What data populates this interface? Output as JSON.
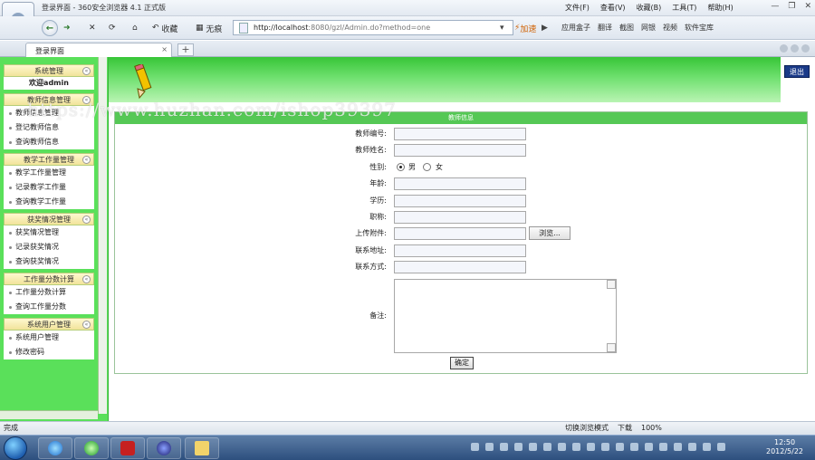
{
  "browser": {
    "title": "登录界面 - 360安全浏览器 4.1 正式版",
    "menus": [
      "文件(F)",
      "查看(V)",
      "收藏(B)",
      "工具(T)",
      "帮助(H)"
    ],
    "back_label": "收藏",
    "nologo_label": "无痕",
    "address_host": "http://localhost",
    "address_path": ":8080/gzl/Admin.do?method=one",
    "accelerate_label": "加速",
    "tools": [
      "应用盒子",
      "翻译",
      "截图",
      "网银",
      "视频",
      "软件宝库"
    ],
    "tab_title": "登录界面",
    "status_text": "完成",
    "status_right": [
      "切换浏览模式",
      "下载",
      "100%"
    ],
    "clock_time": "12:50",
    "clock_date": "2012/5/22"
  },
  "watermark": "https://www.huzhan.com/ishop39397",
  "sidebar": {
    "groups": [
      {
        "title": "系统管理",
        "welcome": "欢迎admin",
        "items": []
      },
      {
        "title": "教师信息管理",
        "items": [
          "教师信息管理",
          "登记教师信息",
          "查询教师信息"
        ]
      },
      {
        "title": "教学工作量管理",
        "items": [
          "教学工作量管理",
          "记录教学工作量",
          "查询教学工作量"
        ]
      },
      {
        "title": "获奖情况管理",
        "items": [
          "获奖情况管理",
          "记录获奖情况",
          "查询获奖情况"
        ]
      },
      {
        "title": "工作量分数计算",
        "items": [
          "工作量分数计算",
          "查询工作量分数"
        ]
      },
      {
        "title": "系统用户管理",
        "items": [
          "系统用户管理",
          "修改密码"
        ]
      }
    ]
  },
  "header": {
    "exit_label": "退出"
  },
  "form": {
    "title": "教师信息",
    "teacher_no_label": "教师编号:",
    "teacher_name_label": "教师姓名:",
    "gender_label": "性别:",
    "gender_male": "男",
    "gender_female": "女",
    "age_label": "年龄:",
    "education_label": "学历:",
    "title_label": "职称:",
    "attachment_label": "上传附件:",
    "browse_label": "浏览...",
    "address_label": "联系地址:",
    "contact_label": "联系方式:",
    "remark_label": "备注:",
    "submit_label": "确定"
  }
}
